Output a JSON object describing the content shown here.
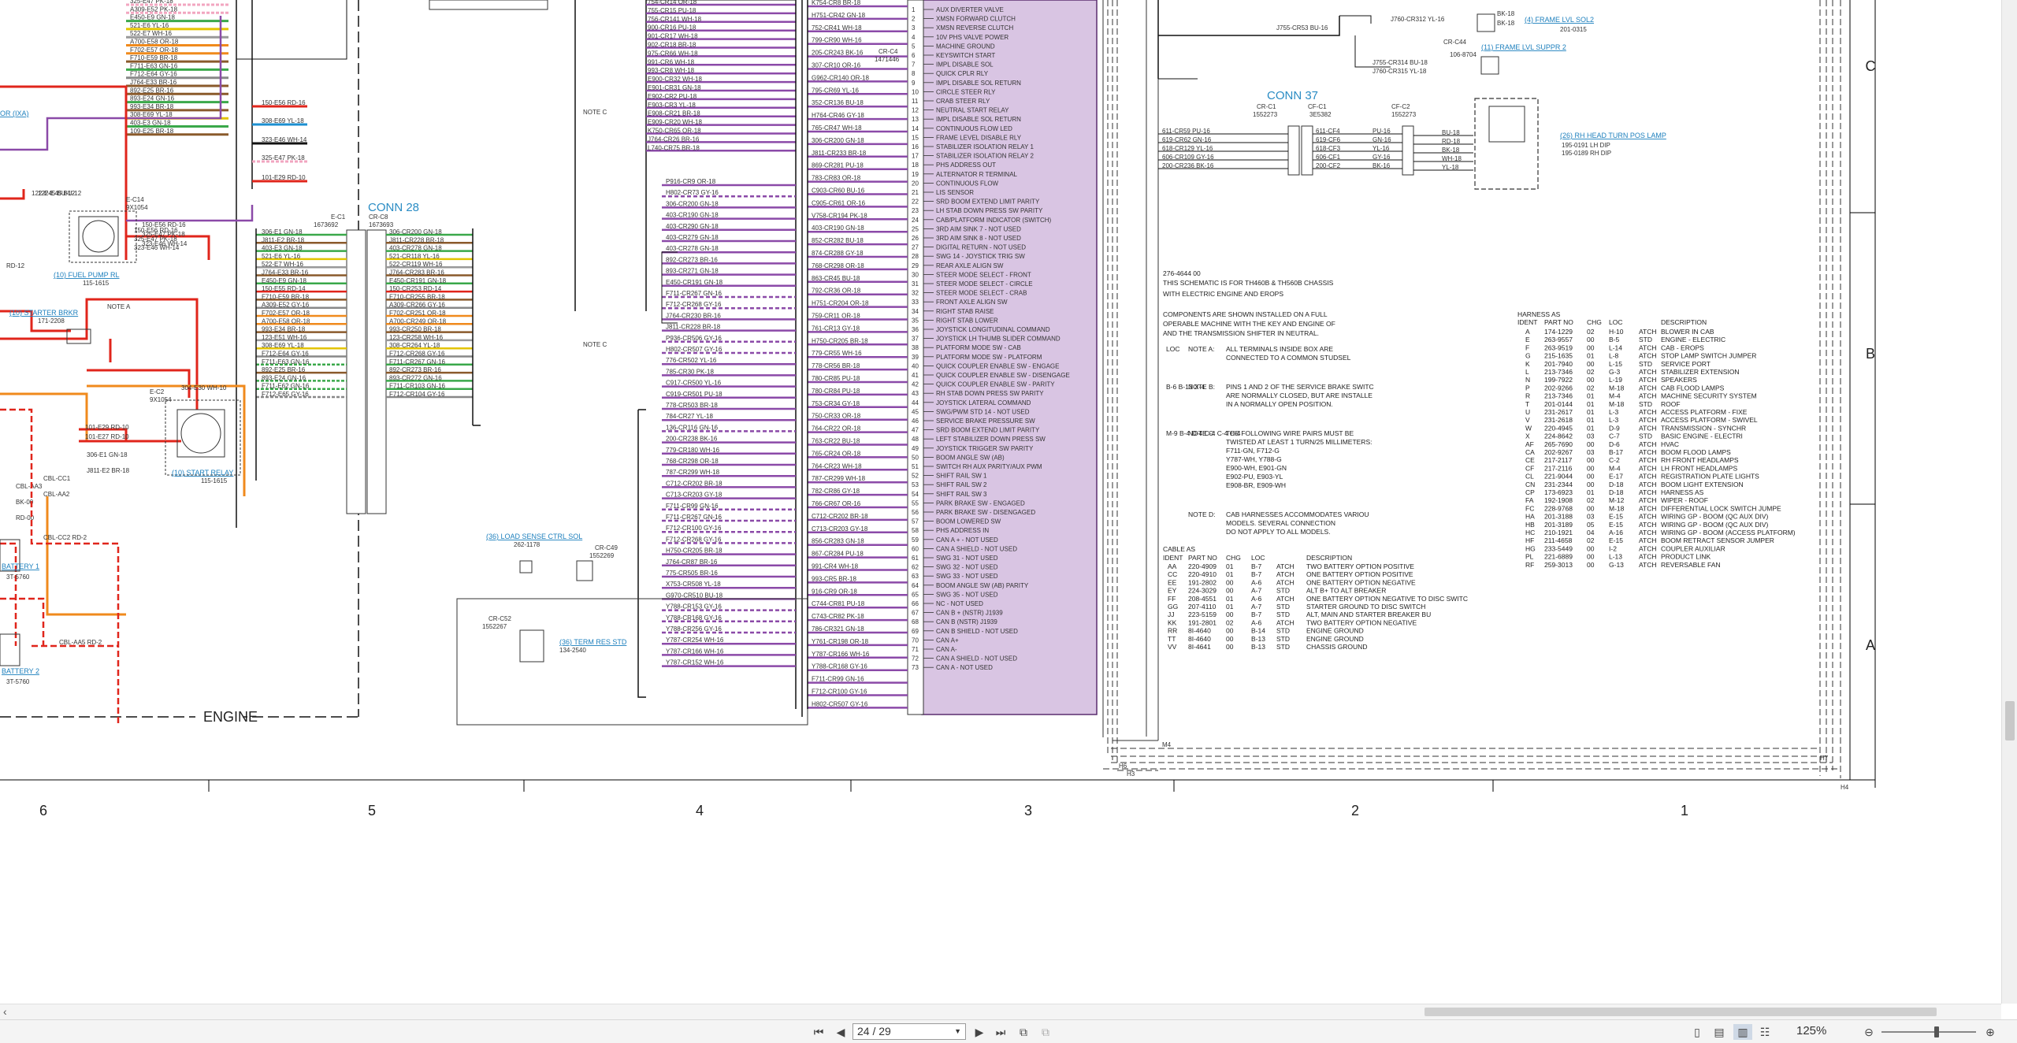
{
  "document": {
    "title_block": {
      "code": "276-4644 00",
      "line1": "THIS SCHEMATIC IS FOR TH460B & TH560B CHASSIS",
      "line2": "WITH ELECTRIC ENGINE AND EROPS",
      "components_note_1": "COMPONENTS ARE SHOWN INSTALLED ON A FULL",
      "components_note_2": "OPERABLE MACHINE WITH THE KEY AND ENGINE OF",
      "components_note_3": "AND THE TRANSMISSION SHIFTER IN NEUTRAL."
    },
    "notes": [
      {
        "loc": "LOC",
        "label": "NOTE A:",
        "text": [
          "ALL TERMINALS INSIDE BOX ARE",
          "CONNECTED TO A COMMON STUDSEL"
        ]
      },
      {
        "loc": "B-6  B-13  X-4",
        "label": "NOTE B:",
        "text": [
          "PINS 1 AND 2 OF THE SERVICE BRAKE SWITC",
          "ARE NORMALLY CLOSED, BUT ARE INSTALLE",
          "IN A NORMALLY OPEN POSITION."
        ]
      },
      {
        "loc": "M-9  B-4  D-4  C-4  C-4  C-4",
        "label": "NOTE C:",
        "text": [
          "THE FOLLOWING WIRE PAIRS MUST BE",
          "TWISTED AT LEAST 1 TURN/25 MILLIMETERS:",
          "F711-GN, F712-G",
          "Y787-WH, Y788-G",
          "E900-WH, E901-GN",
          "E902-PU, E903-YL",
          "E908-BR, E909-WH"
        ]
      },
      {
        "loc": "",
        "label": "NOTE D:",
        "text": [
          "CAB HARNESSES ACCOMMODATES VARIOU",
          "MODELS. SEVERAL CONNECTION",
          "DO NOT APPLY TO ALL MODELS."
        ]
      }
    ],
    "harness_table": {
      "title": "HARNESS AS",
      "headers": [
        "IDENT",
        "PART NO",
        "CHG",
        "LOC",
        "",
        "DESCRIPTION"
      ],
      "rows": [
        [
          "A",
          "174-1229",
          "02",
          "H-10",
          "ATCH",
          "BLOWER IN CAB"
        ],
        [
          "E",
          "263-9557",
          "00",
          "B-5",
          "STD",
          "ENGINE - ELECTRIC"
        ],
        [
          "F",
          "263-9519",
          "00",
          "L-14",
          "ATCH",
          "CAB - EROPS"
        ],
        [
          "G",
          "215-1635",
          "01",
          "L-8",
          "ATCH",
          "STOP LAMP SWITCH JUMPER"
        ],
        [
          "K",
          "201-7940",
          "00",
          "L-15",
          "STD",
          "SERVICE PORT"
        ],
        [
          "L",
          "213-7346",
          "02",
          "G-3",
          "ATCH",
          "STABILIZER EXTENSION"
        ],
        [
          "N",
          "199-7922",
          "00",
          "L-19",
          "ATCH",
          "SPEAKERS"
        ],
        [
          "P",
          "202-9266",
          "02",
          "M-18",
          "ATCH",
          "CAB FLOOD LAMPS"
        ],
        [
          "R",
          "213-7346",
          "01",
          "M-4",
          "ATCH",
          "MACHINE SECURITY SYSTEM"
        ],
        [
          "T",
          "201-0144",
          "01",
          "M-18",
          "STD",
          "ROOF"
        ],
        [
          "U",
          "231-2617",
          "01",
          "L-3",
          "ATCH",
          "ACCESS PLATFORM - FIXE"
        ],
        [
          "V",
          "231-2618",
          "01",
          "L-3",
          "ATCH",
          "ACCESS PLATFORM - SWIVEL"
        ],
        [
          "W",
          "220-4945",
          "01",
          "D-9",
          "ATCH",
          "TRANSMISSION - SYNCHR"
        ],
        [
          "X",
          "224-8642",
          "03",
          "C-7",
          "STD",
          "BASIC ENGINE - ELECTRI"
        ],
        [
          "AF",
          "265-7690",
          "00",
          "D-6",
          "ATCH",
          "HVAC"
        ],
        [
          "CA",
          "202-9267",
          "03",
          "B-17",
          "ATCH",
          "BOOM FLOOD LAMPS"
        ],
        [
          "CE",
          "217-2117",
          "00",
          "C-2",
          "ATCH",
          "RH FRONT HEADLAMPS"
        ],
        [
          "CF",
          "217-2116",
          "00",
          "M-4",
          "ATCH",
          "LH FRONT HEADLAMPS"
        ],
        [
          "CL",
          "221-9044",
          "00",
          "E-17",
          "ATCH",
          "REGISTRATION PLATE LIGHTS"
        ],
        [
          "CN",
          "231-2344",
          "00",
          "D-18",
          "ATCH",
          "BOOM LIGHT EXTENSION"
        ],
        [
          "CP",
          "173-6923",
          "01",
          "D-18",
          "ATCH",
          "HARNESS AS"
        ],
        [
          "FA",
          "192-1908",
          "02",
          "M-12",
          "ATCH",
          "WIPER - ROOF"
        ],
        [
          "FC",
          "228-9768",
          "00",
          "M-18",
          "ATCH",
          "DIFFERENTIAL LOCK SWITCH JUMPE"
        ],
        [
          "HA",
          "201-3188",
          "03",
          "E-15",
          "ATCH",
          "WIRING GP - BOOM (QC AUX DIV)"
        ],
        [
          "HB",
          "201-3189",
          "05",
          "E-15",
          "ATCH",
          "WIRING GP - BOOM (QC AUX DIV)"
        ],
        [
          "HC",
          "210-1921",
          "04",
          "A-16",
          "ATCH",
          "WIRING GP - BOOM (ACCESS PLATFORM)"
        ],
        [
          "HF",
          "211-4658",
          "02",
          "E-15",
          "ATCH",
          "BOOM RETRACT SENSOR JUMPER"
        ],
        [
          "HG",
          "233-5449",
          "00",
          "I-2",
          "ATCH",
          "COUPLER AUXILIAR"
        ],
        [
          "PL",
          "221-6889",
          "00",
          "L-13",
          "ATCH",
          "PRODUCT LINK"
        ],
        [
          "RF",
          "259-3013",
          "00",
          "G-13",
          "ATCH",
          "REVERSABLE FAN"
        ]
      ]
    },
    "cable_table": {
      "title": "CABLE AS",
      "headers": [
        "IDENT",
        "PART NO",
        "CHG",
        "LOC",
        "",
        "DESCRIPTION"
      ],
      "rows": [
        [
          "AA",
          "220-4909",
          "01",
          "B-7",
          "ATCH",
          "TWO BATTERY OPTION POSITIVE"
        ],
        [
          "CC",
          "220-4910",
          "01",
          "B-7",
          "ATCH",
          "ONE BATTERY OPTION POSITIVE"
        ],
        [
          "EE",
          "191-2802",
          "00",
          "A-6",
          "ATCH",
          "ONE BATTERY OPTION NEGATIVE"
        ],
        [
          "EY",
          "224-3029",
          "00",
          "A-7",
          "STD",
          "ALT B+ TO ALT BREAKER"
        ],
        [
          "FF",
          "208-4551",
          "01",
          "A-6",
          "ATCH",
          "ONE BATTERY OPTION NEGATIVE TO DISC SWITC"
        ],
        [
          "GG",
          "207-4110",
          "01",
          "A-7",
          "STD",
          "STARTER GROUND TO DISC SWITCH"
        ],
        [
          "JJ",
          "223-5159",
          "00",
          "B-7",
          "STD",
          "ALT, MAIN AND STARTER BREAKER BU"
        ],
        [
          "KK",
          "191-2801",
          "02",
          "A-6",
          "ATCH",
          "TWO BATTERY OPTION NEGATIVE"
        ],
        [
          "RR",
          "8I-4640",
          "00",
          "B-14",
          "STD",
          "ENGINE GROUND"
        ],
        [
          "TT",
          "8I-4640",
          "00",
          "B-13",
          "STD",
          "ENGINE GROUND"
        ],
        [
          "VV",
          "8I-4641",
          "00",
          "B-13",
          "STD",
          "CHASSIS GROUND"
        ]
      ]
    },
    "connectors": {
      "conn28": "CONN 28",
      "conn37": "CONN 37",
      "engine_label": "ENGINE",
      "ec1": "E-C1",
      "ec1_part": "1673692",
      "cr_c8": "CR-C8",
      "cr_c8_part": "1673693",
      "cfc1": "CF-C1",
      "cfc1_part": "3E5382",
      "cfc2": "CF-C2",
      "cfc2_part": "1552273",
      "crc1": "CR-C1",
      "crc1_part": "1552273",
      "crc4": "CR-C4",
      "crc4_part": "1471446",
      "crc44": "CR-C44",
      "crc44_part": "106-8704",
      "crc49": "CR-C49",
      "crc49_part": "1552269",
      "crc52": "CR-C52",
      "crc52_part": "1552267",
      "ec14": "E-C14",
      "ec14_part": "9X1054",
      "ec2": "E-C2",
      "ec2_part": "9X1054"
    },
    "links": {
      "fuel_pump": "(10) FUEL PUMP RL",
      "fuel_pump_part": "115-1615",
      "starter_brkr": "(10) STARTER BRKR",
      "starter_brkr_part": "171-2208",
      "start_relay": "(10) START RELAY",
      "start_relay_part": "115-1615",
      "load_sense": "(36) LOAD SENSE CTRL SOL",
      "load_sense_part": "262-1178",
      "term_res": "(36) TERM RES STD",
      "term_res_part": "134-2540",
      "frame_lvl_sol": "(4) FRAME LVL SOL2",
      "frame_lvl_sol_part": "201-0315",
      "frame_lvl_suppr": "(11) FRAME LVL SUPPR 2",
      "head_turn": "(26) RH HEAD TURN POS LAMP",
      "head_turn_a": "195-0191  LH DIP",
      "head_turn_b": "195-0189 RH DIP",
      "battery1": "BATTERY 1",
      "battery1_part": "3T-5760",
      "battery2": "BATTERY 2",
      "battery2_part": "3T-5760",
      "ixa": "OR (IXA)"
    },
    "note_a": "NOTE A",
    "note_c": "NOTE C",
    "zone_columns": [
      "6",
      "5",
      "4",
      "3",
      "2",
      "1"
    ],
    "zone_rows": [
      "C",
      "B",
      "A"
    ],
    "wires_left": [
      "325-E47 PK-18",
      "A309-E52 PK-18",
      "E450-E9 GN-18",
      "521-E6 YL-16",
      "522-E7 WH-16",
      "A700-E58 OR-18",
      "F702-E57 OR-18",
      "F710-E59 BR-18",
      "F711-E63 GN-16",
      "F712-E64 GY-16",
      "J764-E33 BR-16",
      "892-E25 BR-16",
      "893-E24 GN-16",
      "993-E34 BR-18",
      "308-E69 YL-18",
      "403-E3 GN-18",
      "109-E25 BR-18"
    ],
    "wires_conn28_left": [
      "306-E1 GN-18",
      "J811-E2 BR-18",
      "403-E3 GN-18",
      "521-E6 YL-16",
      "522-E7 WH-16",
      "J764-E33 BR-16",
      "E450-E9 GN-18",
      "150-E55 RD-14",
      "F710-E59 BR-18",
      "A309-E52 GY-16",
      "F702-E57 OR-18",
      "A700-E58 OR-18",
      "993-E34 BR-18",
      "123-E51 WH-16",
      "308-E69 YL-18",
      "F712-E64 GY-16",
      "F711-E63 GN-16",
      "892-E25 BR-16",
      "893-E24 GN-16",
      "F711-E62 GN-16",
      "F712-E65 GY-16"
    ],
    "wires_conn28_right": [
      "306-CR200 GN-18",
      "J811-CR228 BR-18",
      "403-CR278 GN-18",
      "521-CR118 YL-16",
      "522-CR119 WH-16",
      "J764-CR283 BR-16",
      "E450-CR191 GN-18",
      "150-CR253 RD-14",
      "F710-CR255 BR-18",
      "A309-CR266 GY-16",
      "F702-CR251 OR-18",
      "A700-CR249 OR-18",
      "993-CR250 BR-18",
      "123-CR258 WH-16",
      "308-CR264 YL-18",
      "F712-CR268 GY-16",
      "F711-CR267 GN-16",
      "892-CR273 BR-16",
      "893-CR272 GN-16",
      "F711-CR103 GN-16",
      "F712-CR104 GY-16"
    ],
    "wires_mid": [
      "754-CR14 OR-18",
      "755-CR15 PU-18",
      "756-CR141 WH-18",
      "900-CR16 PU-18",
      "901-CR17 WH-18",
      "902-CR18 BR-18",
      "975-CR66 WH-18",
      "991-CR6 WH-18",
      "993-CR8 WH-18",
      "E900-CR32 WH-18",
      "E901-CR31 GN-18",
      "E902-CR2 PU-18",
      "E903-CR3 YL-18",
      "E908-CR21 BR-18",
      "E909-CR20 WH-18",
      "K750-CR65 OR-18",
      "J764-CR26 BR-16",
      "L740-CR75 BR-18"
    ],
    "wires_mid_lower": [
      "P916-CR9 OR-18",
      "H802-CR73 GY-16",
      "306-CR200 GN-18",
      "403-CR190 GN-18",
      "403-CR290 GN-18",
      "403-CR279 GN-18",
      "403-CR278 GN-18",
      "892-CR273 BR-16",
      "893-CR271 GN-18",
      "E450-CR191 GN-18",
      "F711-CR267 GN-16",
      "F712-CR268 GY-16",
      "J764-CR230 BR-16",
      "J811-CR228 BR-18",
      "P936-CR506 GY-16",
      "H802-CR507 GY-16",
      "776-CR502 YL-16",
      "785-CR30 PK-18",
      "C917-CR500 YL-16",
      "C919-CR501 PU-18",
      "778-CR503 BR-18",
      "784-CR27 YL-18",
      "136-CR116 GN-16",
      "200-CR238 BK-16",
      "779-CR180 WH-16",
      "768-CR298 OR-18",
      "787-CR299 WH-18",
      "C712-CR202 BR-18",
      "C713-CR203 GY-18",
      "F711-CR99 GN-16",
      "F711-CR267 GN-16",
      "F712-CR100 GY-16",
      "F712-CR268 GY-16",
      "H750-CR205 BR-18",
      "J764-CR87 BR-16",
      "775-CR505 BR-16",
      "X753-CR508 YL-18",
      "G970-CR510 BU-18",
      "Y788-CR153 GY-16",
      "Y788-CR168 GY-16",
      "Y788-CR256 GY-16",
      "Y787-CR254 WH-16",
      "Y787-CR166 WH-16",
      "Y787-CR152 WH-16"
    ],
    "wires_purple": [
      "K754-CR8 BR-18",
      "H751-CR42 GN-18",
      "752-CR41 WH-18",
      "799-CR90 WH-16",
      "205-CR243 BK-16",
      "307-CR10 OR-16",
      "G962-CR140 OR-18",
      "795-CR69 YL-16",
      "352-CR136 BU-18",
      "H764-CR46 GY-18",
      "765-CR47 WH-18",
      "306-CR200 GN-18",
      "J811-CR233 BR-18",
      "869-CR281 PU-18",
      "783-CR83 OR-18",
      "C903-CR60 BU-16",
      "C905-CR61 OR-16",
      "V758-CR194 PK-18",
      "403-CR190 GN-18",
      "852-CR282 BU-18",
      "874-CR288 GY-18",
      "768-CR298 OR-18",
      "863-CR45 BU-18",
      "792-CR36 OR-18",
      "H751-CR204 OR-18",
      "759-CR11 OR-18",
      "761-CR13 GY-18",
      "H750-CR205 BR-18",
      "779-CR55 WH-16",
      "778-CR56 BR-18",
      "780-CR85 PU-18",
      "780-CR84 PU-18",
      "753-CR34 GY-18",
      "750-CR33 OR-18",
      "764-CR22 OR-18",
      "763-CR22 BU-18",
      "765-CR24 OR-18",
      "764-CR23 WH-18",
      "787-CR299 WH-18",
      "782-CR86 GY-18",
      "766-CR67 OR-16",
      "C712-CR202 BR-18",
      "C713-CR203 GY-18",
      "856-CR283 GN-18",
      "867-CR284 PU-18",
      "991-CR4 WH-18",
      "993-CR5 BR-18",
      "916-CR9 OR-18",
      "C744-CR81 PU-18",
      "C743-CR82 PK-18",
      "786-CR321 GN-18",
      "Y761-CR198 OR-18",
      "Y787-CR166 WH-16",
      "Y788-CR168 GY-16",
      "F711-CR99 GN-16",
      "F712-CR100 GY-16",
      "H802-CR507 GY-16"
    ],
    "purple_pins": [
      "AUX DIVERTER VALVE",
      "XMSN FORWARD CLUTCH",
      "XMSN REVERSE CLUTCH",
      "10V PHS VALVE POWER",
      "MACHINE GROUND",
      "KEYSWITCH START",
      "IMPL DISABLE SOL",
      "QUICK CPLR RLY",
      "IMPL DISABLE SOL RETURN",
      "CIRCLE STEER RLY",
      "CRAB STEER RLY",
      "NEUTRAL START RELAY",
      "IMPL DISABLE SOL RETURN",
      "CONTINUOUS FLOW LED",
      "FRAME LEVEL DISABLE RLY",
      "STABILIZER ISOLATION RELAY 1",
      "STABILIZER ISOLATION RELAY 2",
      "PHS ADDRESS OUT",
      "ALTERNATOR R TERMINAL",
      "CONTINUOUS FLOW",
      "LIS SENSOR",
      "SRD BOOM EXTEND LIMIT PARITY",
      "LH STAB DOWN PRESS SW PARITY",
      "CAB/PLATFORM INDICATOR (SWITCH)",
      "3RD AIM SINK 7 - NOT USED",
      "3RD AIM SINK 8 - NOT USED",
      "DIGITAL RETURN - NOT USED",
      "SWG 14 - JOYSTICK TRIG SW",
      "REAR AXLE ALIGN SW",
      "STEER MODE SELECT - FRONT",
      "STEER MODE SELECT - CIRCLE",
      "STEER MODE SELECT - CRAB",
      "FRONT AXLE ALIGN SW",
      "RIGHT STAB RAISE",
      "RIGHT STAB LOWER",
      "JOYSTICK LONGITUDINAL COMMAND",
      "JOYSTICK LH THUMB SLIDER COMMAND",
      "PLATFORM MODE SW - CAB",
      "PLATFORM MODE SW - PLATFORM",
      "QUICK COUPLER ENABLE SW - ENGAGE",
      "QUICK COUPLER ENABLE SW - DISENGAGE",
      "QUICK COUPLER ENABLE SW - PARITY",
      "RH STAB DOWN PRESS SW PARITY",
      "JOYSTICK LATERAL COMMAND",
      "SWG/PWM STD 14 - NOT USED",
      "SERVICE BRAKE PRESSURE SW",
      "SRD BOOM EXTEND LIMIT PARITY",
      "LEFT STABILIZER DOWN PRESS SW",
      "JOYSTICK TRIGGER SW PARITY",
      "BOOM ANGLE SW (AB)",
      "SWITCH RH AUX PARITY/AUX PWM",
      "SHIFT RAIL SW 1",
      "SHIFT RAIL SW 2",
      "SHIFT RAIL SW 3",
      "PARK BRAKE SW - ENGAGED",
      "PARK BRAKE SW - DISENGAGED",
      "BOOM LOWERED SW",
      "PHS ADDRESS IN",
      "CAN A + - NOT USED",
      "CAN A SHIELD - NOT USED",
      "SWG 31 - NOT USED",
      "SWG 32 - NOT USED",
      "SWG 33 - NOT USED",
      "BOOM ANGLE SW (AB) PARITY",
      "SWG 35 - NOT USED",
      "NC - NOT USED",
      "CAN B + (NSTR) J1939",
      "CAN B (NSTR) J1939",
      "CAN B SHIELD - NOT USED",
      "CAN A+",
      "CAN A-",
      "CAN A SHIELD - NOT USED",
      "CAN A - NOT USED"
    ],
    "conn37_left": [
      "611-CR59 PU-16",
      "619-CR62 GN-16",
      "618-CR129 YL-16",
      "606-CR109 GY-16",
      "200-CR236 BK-16"
    ],
    "conn37_mid": [
      "611-CF4",
      "619-CF6",
      "618-CF3",
      "606-CF1",
      "200-CF2"
    ],
    "conn37_right": [
      "PU-16",
      "GN-16",
      "YL-16",
      "GY-16",
      "BK-16"
    ],
    "conn37_far": [
      "BU-18",
      "RD-18",
      "BK-18",
      "WH-18",
      "YL-18"
    ],
    "top_right_wires": [
      "J760-CR312 YL-16",
      "J755-CR53 BU-16",
      "J755-CR314 BU-18",
      "J760-CR315 YL-18",
      "BK-18",
      "BK-18"
    ],
    "sheet_marks": [
      "H6",
      "H7",
      "H4",
      "M4",
      "H3"
    ],
    "engine_wires": [
      "150-E56 RD-16",
      "325-E47 PK-18",
      "323-E46 WH-14",
      "122-E45 BU-12",
      "306-E1 GN-18",
      "J811-E2 BR-18",
      "101-E29 RD-10",
      "101-E27 RD-10",
      "304-E30 WH-10",
      "RD-12",
      "CBL-CC2 RD-2",
      "CBL-AA5 RD-2",
      "CBL-AA2",
      "CBL-CC1",
      "CBL-AA3",
      "BK-00",
      "RD-00"
    ]
  },
  "viewer": {
    "page_current": "24 / 29",
    "zoom": "125%"
  },
  "colors": {
    "purple": "#8b4aa8",
    "purple_fill": "#c9b3d6",
    "red": "#e0251b",
    "blue": "#1c8fd0",
    "orange": "#f08a1c",
    "pink": "#f2a6c0",
    "green": "#3aa84a",
    "link": "#1c7fbd"
  }
}
